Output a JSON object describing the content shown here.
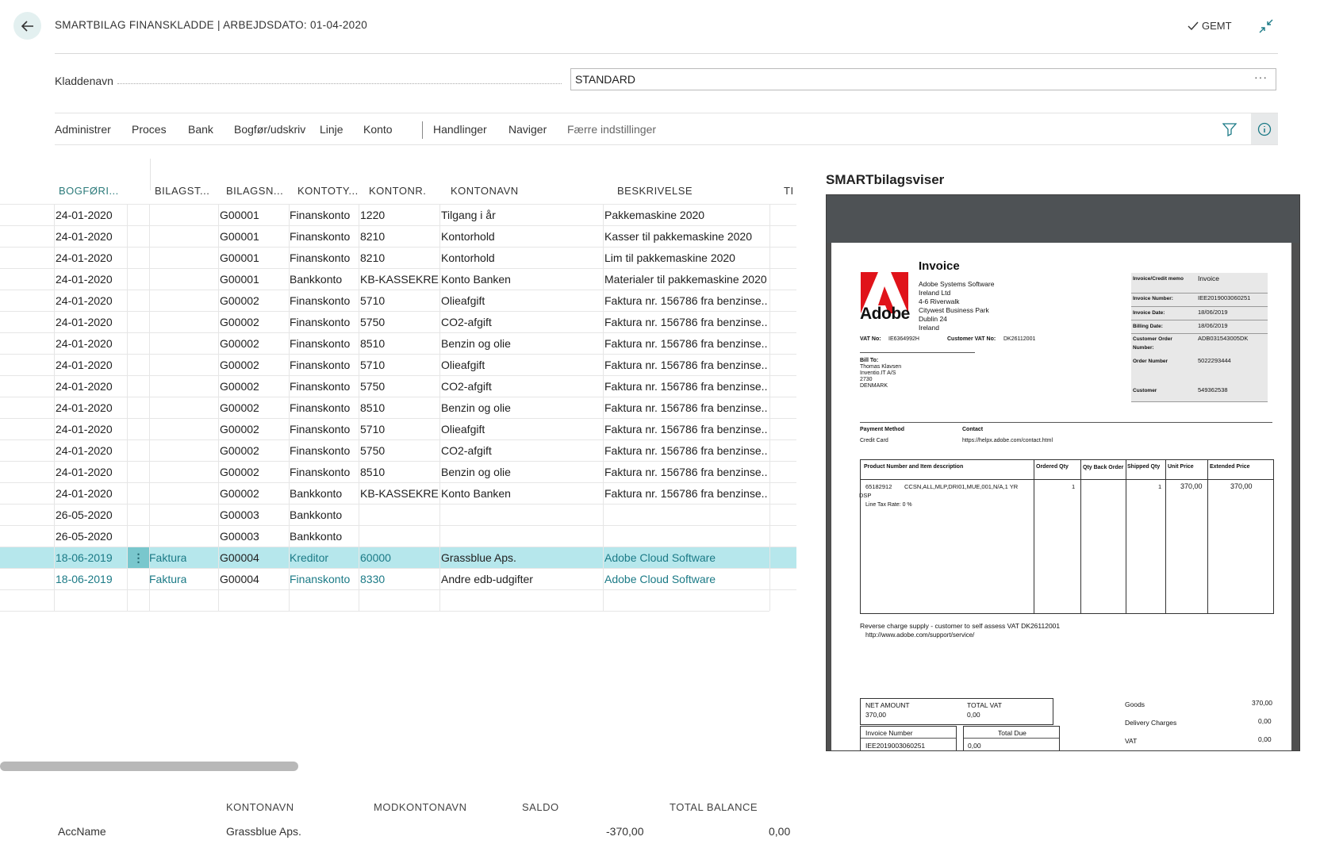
{
  "header": {
    "title": "SMARTBILAG FINANSKLADDE | ARBEJDSDATO: 01-04-2020",
    "saved_label": "GEMT"
  },
  "field": {
    "label": "Kladdenavn",
    "value": "STANDARD",
    "more": "···"
  },
  "actions": [
    "Administrer",
    "Proces",
    "Bank",
    "Bogfør/udskriv",
    "Linje",
    "Konto",
    "Handlinger",
    "Naviger",
    "Færre indstillinger"
  ],
  "columns": [
    "BOGFØRI...",
    "BILAGST...",
    "BILAGSN...",
    "KONTOTY...",
    "KONTONR.",
    "KONTONAVN",
    "BESKRIVELSE",
    "TI"
  ],
  "rows": [
    {
      "date": "24-01-2020",
      "type": "",
      "doc": "G00001",
      "acctype": "Finanskonto",
      "accno": "1220",
      "accname": "Tilgang i år",
      "desc": "Pakkemaskine 2020"
    },
    {
      "date": "24-01-2020",
      "type": "",
      "doc": "G00001",
      "acctype": "Finanskonto",
      "accno": "8210",
      "accname": "Kontorhold",
      "desc": "Kasser til pakkemaskine 2020"
    },
    {
      "date": "24-01-2020",
      "type": "",
      "doc": "G00001",
      "acctype": "Finanskonto",
      "accno": "8210",
      "accname": "Kontorhold",
      "desc": "Lim til pakkemaskine 2020"
    },
    {
      "date": "24-01-2020",
      "type": "",
      "doc": "G00001",
      "acctype": "Bankkonto",
      "accno": "KB-KASSEKRE...",
      "accname": "Konto Banken",
      "desc": "Materialer til pakkemaskine 2020"
    },
    {
      "date": "24-01-2020",
      "type": "",
      "doc": "G00002",
      "acctype": "Finanskonto",
      "accno": "5710",
      "accname": "Olieafgift",
      "desc": "Faktura nr. 156786 fra benzinse..."
    },
    {
      "date": "24-01-2020",
      "type": "",
      "doc": "G00002",
      "acctype": "Finanskonto",
      "accno": "5750",
      "accname": "CO2-afgift",
      "desc": "Faktura nr. 156786 fra benzinse..."
    },
    {
      "date": "24-01-2020",
      "type": "",
      "doc": "G00002",
      "acctype": "Finanskonto",
      "accno": "8510",
      "accname": "Benzin og olie",
      "desc": "Faktura nr. 156786 fra benzinse..."
    },
    {
      "date": "24-01-2020",
      "type": "",
      "doc": "G00002",
      "acctype": "Finanskonto",
      "accno": "5710",
      "accname": "Olieafgift",
      "desc": "Faktura nr. 156786 fra benzinse..."
    },
    {
      "date": "24-01-2020",
      "type": "",
      "doc": "G00002",
      "acctype": "Finanskonto",
      "accno": "5750",
      "accname": "CO2-afgift",
      "desc": "Faktura nr. 156786 fra benzinse..."
    },
    {
      "date": "24-01-2020",
      "type": "",
      "doc": "G00002",
      "acctype": "Finanskonto",
      "accno": "8510",
      "accname": "Benzin og olie",
      "desc": "Faktura nr. 156786 fra benzinse..."
    },
    {
      "date": "24-01-2020",
      "type": "",
      "doc": "G00002",
      "acctype": "Finanskonto",
      "accno": "5710",
      "accname": "Olieafgift",
      "desc": "Faktura nr. 156786 fra benzinse..."
    },
    {
      "date": "24-01-2020",
      "type": "",
      "doc": "G00002",
      "acctype": "Finanskonto",
      "accno": "5750",
      "accname": "CO2-afgift",
      "desc": "Faktura nr. 156786 fra benzinse..."
    },
    {
      "date": "24-01-2020",
      "type": "",
      "doc": "G00002",
      "acctype": "Finanskonto",
      "accno": "8510",
      "accname": "Benzin og olie",
      "desc": "Faktura nr. 156786 fra benzinse..."
    },
    {
      "date": "24-01-2020",
      "type": "",
      "doc": "G00002",
      "acctype": "Bankkonto",
      "accno": "KB-KASSEKRE...",
      "accname": "Konto Banken",
      "desc": "Faktura nr. 156786 fra benzinse..."
    },
    {
      "date": "26-05-2020",
      "type": "",
      "doc": "G00003",
      "acctype": "Bankkonto",
      "accno": "",
      "accname": "",
      "desc": ""
    },
    {
      "date": "26-05-2020",
      "type": "",
      "doc": "G00003",
      "acctype": "Bankkonto",
      "accno": "",
      "accname": "",
      "desc": ""
    },
    {
      "date": "18-06-2019",
      "type": "Faktura",
      "doc": "G00004",
      "acctype": "Kreditor",
      "accno": "60000",
      "accname": "Grassblue Aps.",
      "desc": "Adobe Cloud Software",
      "selected": true,
      "row_menu": "⋮"
    },
    {
      "date": "18-06-2019",
      "type": "Faktura",
      "doc": "G00004",
      "acctype": "Finanskonto",
      "accno": "8330",
      "accname": "Andre edb-udgifter",
      "desc": "Adobe Cloud Software"
    },
    {
      "date": "",
      "type": "",
      "doc": "",
      "acctype": "",
      "accno": "",
      "accname": "",
      "desc": ""
    }
  ],
  "totals": {
    "headers": [
      "KONTONAVN",
      "MODKONTONAVN",
      "SALDO",
      "TOTAL BALANCE"
    ],
    "acc_label": "AccName",
    "acc_name": "Grassblue Aps.",
    "saldo": "-370,00",
    "total_balance": "0,00"
  },
  "viewer": {
    "title": "SMARTbilagsviser",
    "invoice": {
      "heading": "Invoice",
      "logo_text": "Adobe",
      "vendor": [
        "Adobe Systems Software",
        "Ireland Ltd",
        "4-6 Riverwalk",
        "Citywest Business Park",
        "Dublin 24",
        "Ireland"
      ],
      "vat_no_label": "VAT No:",
      "vat_no": "IE6364992H",
      "customer_vat_label": "Customer VAT No:",
      "customer_vat": "DK26112001",
      "meta": [
        {
          "label": "Invoice/Credit memo",
          "value": "Invoice"
        },
        {
          "label": "Invoice Number:",
          "value": "IEE2019003060251"
        },
        {
          "label": "Invoice Date:",
          "value": "18/06/2019"
        },
        {
          "label": "Billing Date:",
          "value": "18/06/2019"
        },
        {
          "label": "Customer Order",
          "value": "ADB031543005DK"
        },
        {
          "label": "Number:",
          "value": ""
        },
        {
          "label": "Order Number",
          "value": "5022293444"
        },
        {
          "label": "Customer",
          "value": "549362538"
        }
      ],
      "bill_to_label": "Bill To:",
      "bill_to": [
        "Thomas Klavsen",
        "Inventio.IT A/S",
        "2730",
        "DENMARK"
      ],
      "payment_method_label": "Payment Method",
      "payment_method": "Credit Card",
      "contact_label": "Contact",
      "contact": "https://helpx.adobe.com/contact.html",
      "table_headers": [
        "Product Number and Item description",
        "Ordered Qty",
        "Qty Back Order",
        "Shipped Qty",
        "Unit Price",
        "Extended Price"
      ],
      "item": {
        "number": "65182912",
        "desc": "CCSN,ALL,MLP,DRI01,MUE,001,N/A,1 YR",
        "desc2": "DSP",
        "ordered": "1",
        "shipped": "1",
        "unit": "370,00",
        "extended": "370,00",
        "tax": "Line Tax Rate: 0   %"
      },
      "reverse_charge": "Reverse charge supply - customer to self assess VAT  DK26112001",
      "support_url": "http://www.adobe.com/support/service/",
      "net_amount_label": "NET AMOUNT",
      "net_amount": "370,00",
      "total_vat_label": "TOTAL VAT",
      "total_vat": "0,00",
      "invoice_number_label": "Invoice Number",
      "invoice_number": "IEE2019003060251",
      "total_due_label": "Total Due",
      "total_due": "0,00",
      "goods_label": "Goods",
      "goods": "370,00",
      "delivery_label": "Delivery Charges",
      "delivery": "0,00",
      "vat_label": "VAT",
      "vat": "0,00"
    }
  },
  "colors": {
    "accent": "#1b7a86",
    "selected_row": "#b6e7ec",
    "row_menu": "#79c7cd"
  }
}
